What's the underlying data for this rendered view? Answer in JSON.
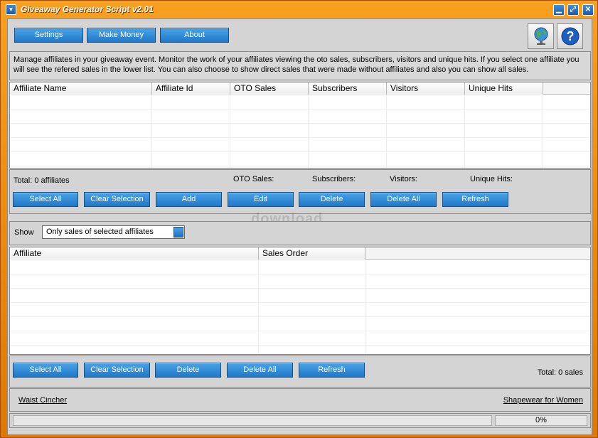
{
  "window": {
    "title": "Giveaway Generator Script v2.01"
  },
  "toolbar": {
    "settings": "Settings",
    "make_money": "Make Money",
    "about": "About"
  },
  "description": "Manage affiliates in your giveaway event. Monitor the work of your affiliates viewing the oto sales,  subscribers, visitors and unique hits. If you select one affiliate you will see  the refered sales in the lower list.  You can also choose to show direct sales that were made without affiliates and also you can show all sales.",
  "affiliates_table": {
    "columns": [
      "Affiliate Name",
      "Affiliate Id",
      "OTO Sales",
      "Subscribers",
      "Visitors",
      "Unique Hits"
    ]
  },
  "affiliates_summary": {
    "total": "Total: 0 affiliates",
    "oto_sales": "OTO Sales:",
    "subscribers": "Subscribers:",
    "visitors": "Visitors:",
    "unique_hits": "Unique Hits:"
  },
  "affiliate_buttons": {
    "select_all": "Select All",
    "clear_selection": "Clear Selection",
    "add": "Add",
    "edit": "Edit",
    "delete": "Delete",
    "delete_all": "Delete All",
    "refresh": "Refresh"
  },
  "filter": {
    "label": "Show",
    "selected": "Only sales of selected affiliates"
  },
  "sales_table": {
    "columns": [
      "Affiliate",
      "Sales Order"
    ]
  },
  "sales_buttons": {
    "select_all": "Select All",
    "clear_selection": "Clear Selection",
    "delete": "Delete",
    "delete_all": "Delete All",
    "refresh": "Refresh"
  },
  "sales_summary": {
    "total": "Total: 0 sales"
  },
  "links": {
    "left": "Waist Cincher",
    "right": "Shapewear for Women"
  },
  "status": {
    "progress": "0%"
  },
  "watermark": "download"
}
